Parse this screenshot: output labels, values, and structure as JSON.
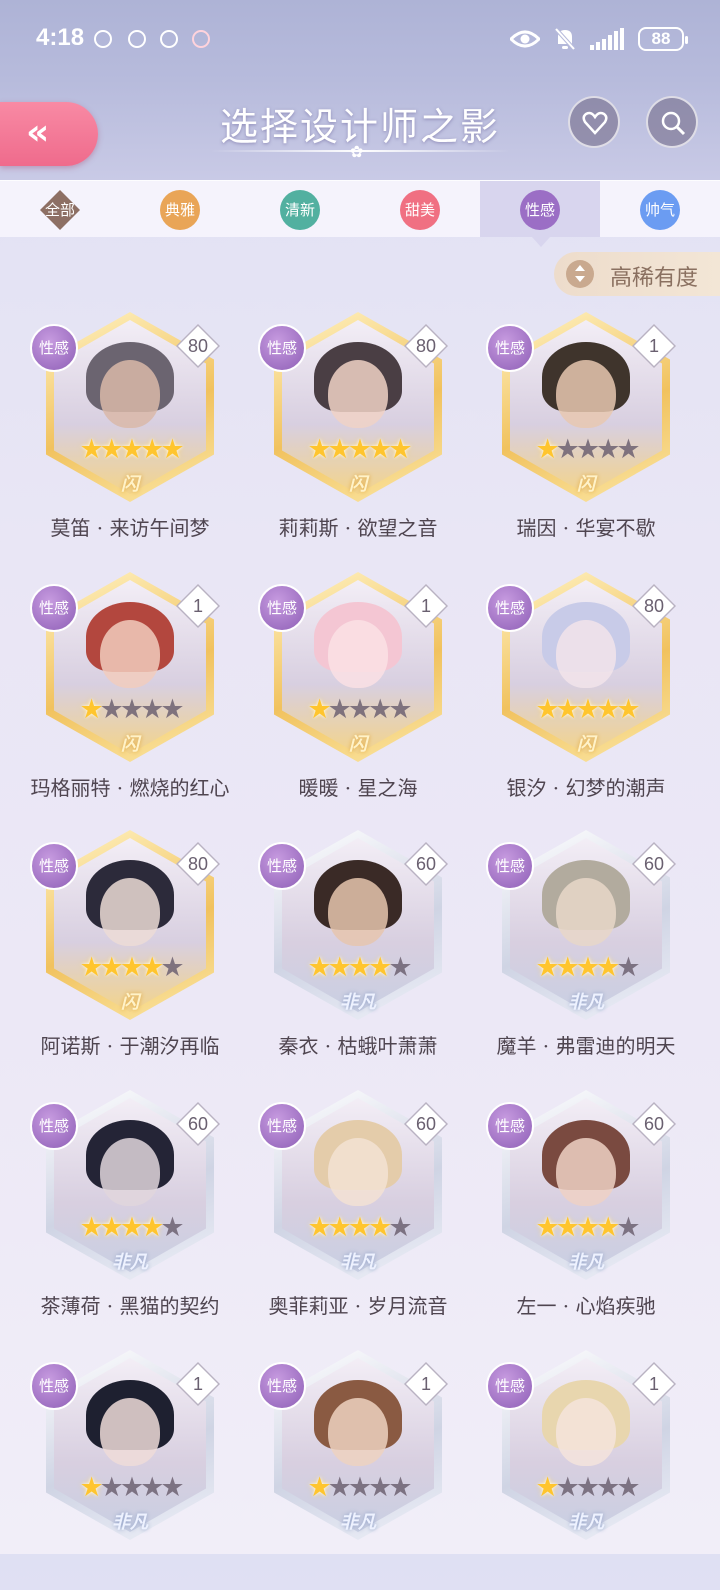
{
  "status_bar": {
    "time": "4:18",
    "battery": "88"
  },
  "header": {
    "title": "选择设计师之影",
    "back_label": "«"
  },
  "tabs": [
    {
      "label": "全部",
      "color": "#8d6f64"
    },
    {
      "label": "典雅",
      "color": "#e9a557"
    },
    {
      "label": "清新",
      "color": "#52b0a0"
    },
    {
      "label": "甜美",
      "color": "#f07082"
    },
    {
      "label": "性感",
      "color": "#9b6ec5"
    },
    {
      "label": "帅气",
      "color": "#6b9cf2"
    }
  ],
  "active_tab": "性感",
  "sort": {
    "label": "高稀有度"
  },
  "cards": [
    {
      "name": "莫笛 · 来访午间梦",
      "type": "性感",
      "level": "80",
      "stars": 5,
      "rarity": "闪"
    },
    {
      "name": "莉莉斯 · 欲望之音",
      "type": "性感",
      "level": "80",
      "stars": 5,
      "rarity": "闪"
    },
    {
      "name": "瑞因 · 华宴不歇",
      "type": "性感",
      "level": "1",
      "stars": 1,
      "rarity": "闪"
    },
    {
      "name": "玛格丽特 · 燃烧的红心",
      "type": "性感",
      "level": "1",
      "stars": 1,
      "rarity": "闪"
    },
    {
      "name": "暖暖 · 星之海",
      "type": "性感",
      "level": "1",
      "stars": 1,
      "rarity": "闪"
    },
    {
      "name": "银汐 · 幻梦的潮声",
      "type": "性感",
      "level": "80",
      "stars": 5,
      "rarity": "闪"
    },
    {
      "name": "阿诺斯 · 于潮汐再临",
      "type": "性感",
      "level": "80",
      "stars": 4,
      "rarity": "闪"
    },
    {
      "name": "秦衣 · 枯蛾叶萧萧",
      "type": "性感",
      "level": "60",
      "stars": 4,
      "rarity": "非凡"
    },
    {
      "name": "魔羊 · 弗雷迪的明天",
      "type": "性感",
      "level": "60",
      "stars": 4,
      "rarity": "非凡"
    },
    {
      "name": "茶薄荷 · 黑猫的契约",
      "type": "性感",
      "level": "60",
      "stars": 4,
      "rarity": "非凡"
    },
    {
      "name": "奥菲莉亚 · 岁月流音",
      "type": "性感",
      "level": "60",
      "stars": 4,
      "rarity": "非凡"
    },
    {
      "name": "左一 · 心焰疾驰",
      "type": "性感",
      "level": "60",
      "stars": 4,
      "rarity": "非凡"
    },
    {
      "name": "",
      "type": "性感",
      "level": "1",
      "stars": 1,
      "rarity": "非凡"
    },
    {
      "name": "",
      "type": "性感",
      "level": "1",
      "stars": 1,
      "rarity": "非凡"
    },
    {
      "name": "",
      "type": "性感",
      "level": "1",
      "stars": 1,
      "rarity": "非凡"
    }
  ],
  "colors": {
    "accent_pink": "#ef6b8c",
    "badge_purple": "#9b6ec5",
    "gold_frame": "#f1c25e",
    "star": "#ffc52e"
  }
}
